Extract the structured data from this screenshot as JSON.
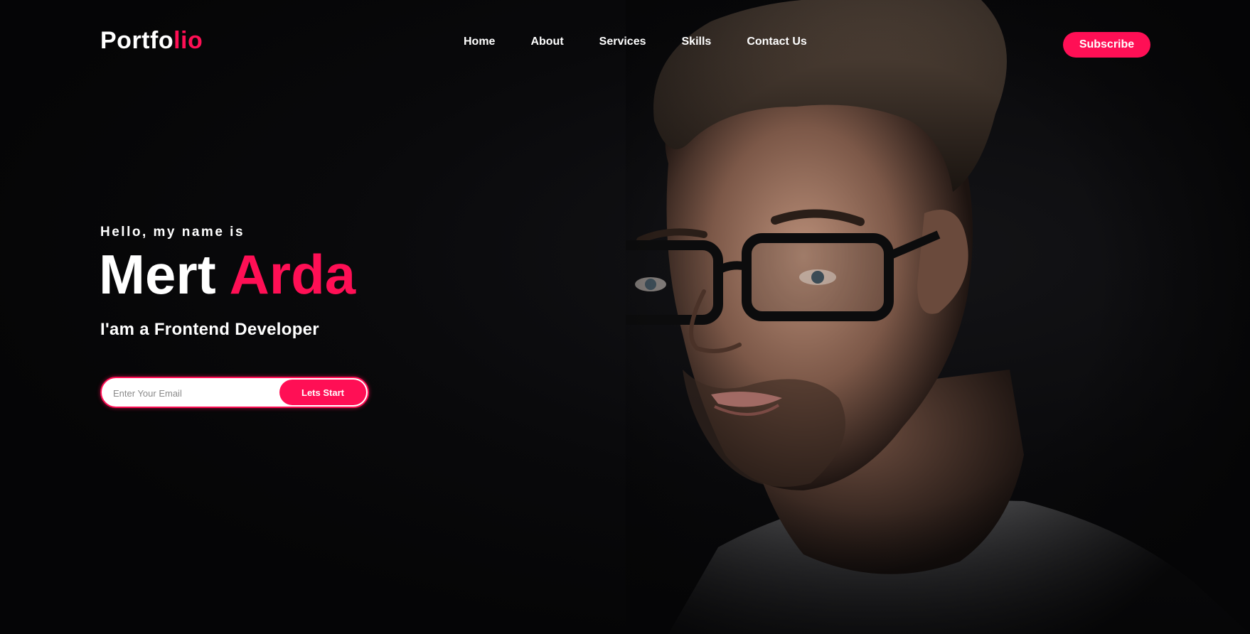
{
  "brand": {
    "logo_main": "Portfo",
    "logo_accent": "lio",
    "accent_color": "#ff0f55"
  },
  "nav": {
    "items": [
      {
        "label": "Home"
      },
      {
        "label": "About"
      },
      {
        "label": "Services"
      },
      {
        "label": "Skills"
      },
      {
        "label": "Contact Us"
      }
    ]
  },
  "header": {
    "subscribe_label": "Subscribe"
  },
  "hero": {
    "greeting": "Hello, my name is",
    "first_name": "Mert",
    "last_name": "Arda",
    "role": "I'am a Frontend Developer",
    "email_placeholder": "Enter Your Email",
    "email_value": "",
    "cta_label": "Lets Start"
  },
  "background": {
    "image": "portrait-photo"
  }
}
